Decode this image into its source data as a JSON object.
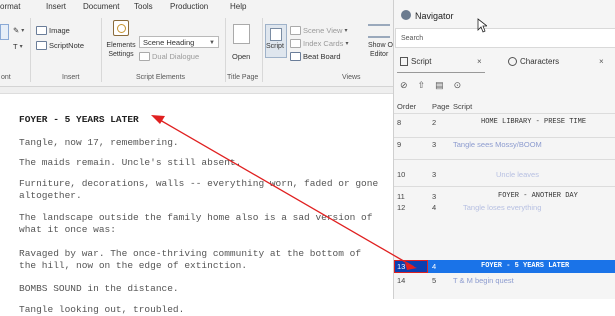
{
  "ribbon": {
    "tabs": [
      "ormat",
      "Insert",
      "Document",
      "Tools",
      "Production",
      "Help"
    ],
    "groups": [
      "ont",
      "Insert",
      "Script Elements",
      "Title Page",
      "Views"
    ],
    "insert": {
      "image": "Image",
      "scriptnote": "ScriptNote"
    },
    "elements": {
      "elements_settings": "Elements\nSettings",
      "scene_heading": "Scene Heading",
      "dual_dialogue": "Dual Dialogue"
    },
    "title_page": {
      "open": "Open"
    },
    "views": {
      "script": "Script",
      "scene_view": "Scene View",
      "index_cards": "Index Cards",
      "beat_board": "Beat Board",
      "show_outline": "Show Outli",
      "editor": "Editor"
    }
  },
  "script": {
    "heading": "FOYER - 5 YEARS LATER",
    "lines": [
      "Tangle, now 17, remembering.",
      "The maids remain. Uncle's still absent.",
      "Furniture, decorations, walls -- everything worn, faded or gone altogether.",
      "The landscape outside the family home also is a sad version of what it once was:",
      "Ravaged by war. The once-thriving community at the bottom of the hill, now on the edge of extinction.",
      "BOMBS SOUND in the distance.",
      "Tangle looking out, troubled."
    ]
  },
  "navigator": {
    "title": "Navigator",
    "search_placeholder": "Search",
    "tabs": {
      "script": "Script",
      "characters": "Characters",
      "close": "×"
    },
    "columns": {
      "order": "Order",
      "page": "Page",
      "script": "Script"
    },
    "rows": [
      {
        "order": "8",
        "page": "2",
        "text": "HOME LIBRARY - PRESE TIME",
        "type": "heading"
      },
      {
        "order": "9",
        "page": "3",
        "text": "Tangle sees Mossy/BOOM",
        "type": "note"
      },
      {
        "order": "10",
        "page": "3",
        "text": "Uncle leaves",
        "type": "note-light"
      },
      {
        "order": "11",
        "page": "3",
        "text": "FOYER - ANOTHER DAY",
        "type": "heading"
      },
      {
        "order": "12",
        "page": "4",
        "text": "Tangle loses everything",
        "type": "note-light"
      },
      {
        "order": "13",
        "page": "4",
        "text": "FOYER - 5 YEARS LATER",
        "type": "selected"
      },
      {
        "order": "14",
        "page": "5",
        "text": "T & M begin quest",
        "type": "note"
      }
    ]
  },
  "colors": {
    "selection": "#1a73e8",
    "annotation_arrow": "#e02020",
    "note_text": "#8c9bcf"
  }
}
